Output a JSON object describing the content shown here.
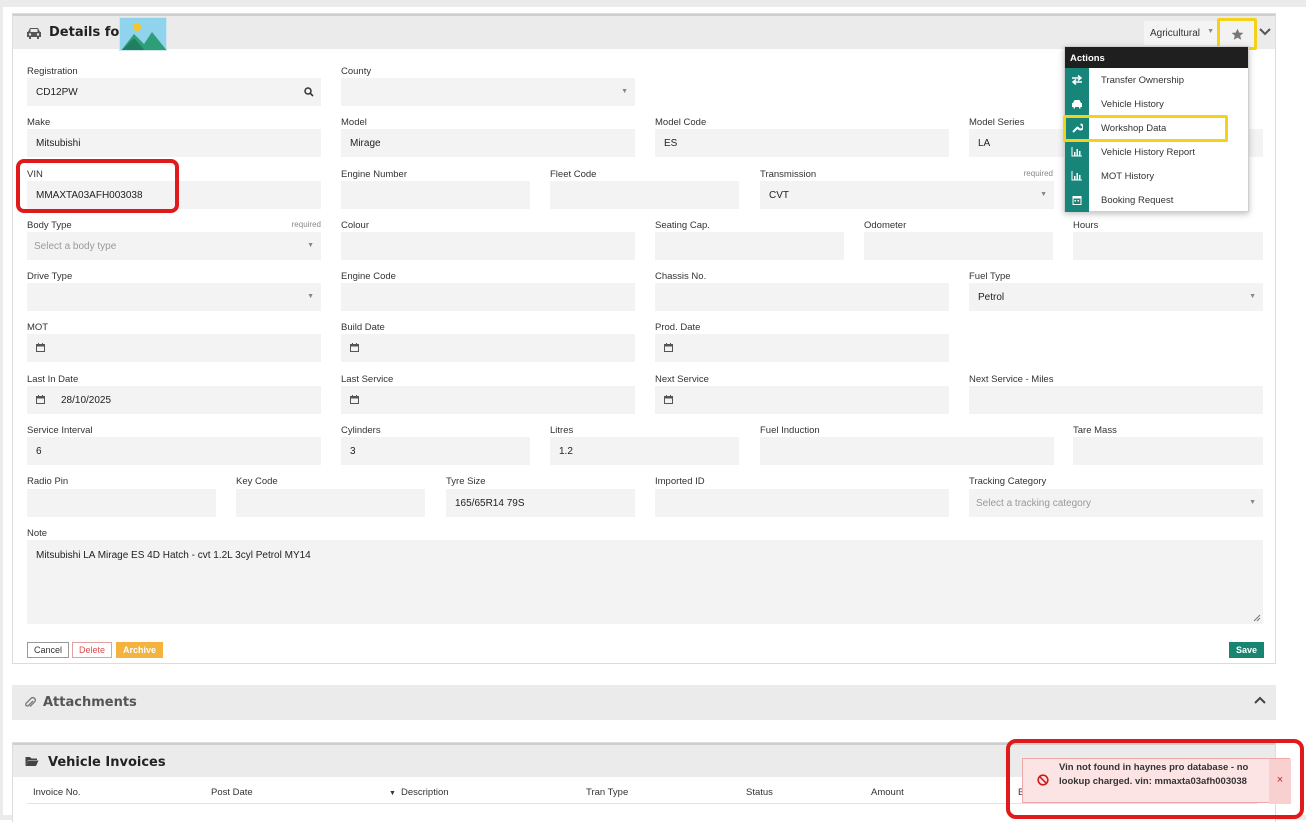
{
  "details": {
    "title": "Details for",
    "vehicle_type": "Agricultural"
  },
  "actions": {
    "heading": "Actions",
    "items": [
      {
        "label": "Transfer Ownership",
        "icon": "transfer-icon"
      },
      {
        "label": "Vehicle History",
        "icon": "car-icon"
      },
      {
        "label": "Workshop Data",
        "icon": "wrench-icon"
      },
      {
        "label": "Vehicle History Report",
        "icon": "bar-chart-icon"
      },
      {
        "label": "MOT History",
        "icon": "bar-chart-icon"
      },
      {
        "label": "Booking Request",
        "icon": "calendar-icon"
      }
    ]
  },
  "form": {
    "registration": {
      "label": "Registration",
      "value": "CD12PW"
    },
    "county": {
      "label": "County",
      "value": ""
    },
    "make": {
      "label": "Make",
      "value": "Mitsubishi"
    },
    "model": {
      "label": "Model",
      "value": "Mirage"
    },
    "model_code": {
      "label": "Model Code",
      "value": "ES"
    },
    "model_series": {
      "label": "Model Series",
      "value": "LA"
    },
    "vin": {
      "label": "VIN",
      "value": "MMAXTA03AFH003038"
    },
    "engine_number": {
      "label": "Engine Number",
      "value": ""
    },
    "fleet_code": {
      "label": "Fleet Code",
      "value": ""
    },
    "transmission": {
      "label": "Transmission",
      "required": "required",
      "value": "CVT"
    },
    "body_type": {
      "label": "Body Type",
      "required": "required",
      "placeholder": "Select a body type"
    },
    "colour": {
      "label": "Colour",
      "value": ""
    },
    "seating_cap": {
      "label": "Seating Cap.",
      "value": ""
    },
    "odometer": {
      "label": "Odometer",
      "value": ""
    },
    "hours": {
      "label": "Hours",
      "value": ""
    },
    "drive_type": {
      "label": "Drive Type",
      "value": ""
    },
    "engine_code": {
      "label": "Engine Code",
      "value": ""
    },
    "chassis_no": {
      "label": "Chassis No.",
      "value": ""
    },
    "fuel_type": {
      "label": "Fuel Type",
      "value": "Petrol"
    },
    "mot": {
      "label": "MOT",
      "value": ""
    },
    "build_date": {
      "label": "Build Date",
      "value": ""
    },
    "prod_date": {
      "label": "Prod. Date",
      "value": ""
    },
    "last_in_date": {
      "label": "Last In Date",
      "value": "28/10/2025"
    },
    "last_service": {
      "label": "Last Service",
      "value": ""
    },
    "next_service": {
      "label": "Next Service",
      "value": ""
    },
    "next_service_miles": {
      "label": "Next Service - Miles",
      "value": ""
    },
    "service_interval": {
      "label": "Service Interval",
      "value": "6"
    },
    "cylinders": {
      "label": "Cylinders",
      "value": "3"
    },
    "litres": {
      "label": "Litres",
      "value": "1.2"
    },
    "fuel_induction": {
      "label": "Fuel Induction",
      "value": ""
    },
    "tare_mass": {
      "label": "Tare Mass",
      "value": ""
    },
    "radio_pin": {
      "label": "Radio Pin",
      "value": ""
    },
    "key_code": {
      "label": "Key Code",
      "value": ""
    },
    "tyre_size": {
      "label": "Tyre Size",
      "value": "165/65R14 79S"
    },
    "imported_id": {
      "label": "Imported ID",
      "value": ""
    },
    "tracking_category": {
      "label": "Tracking Category",
      "placeholder": "Select a tracking category"
    },
    "note": {
      "label": "Note",
      "value": "Mitsubishi LA Mirage ES 4D Hatch - cvt 1.2L 3cyl Petrol MY14"
    }
  },
  "buttons": {
    "cancel": "Cancel",
    "delete": "Delete",
    "archive": "Archive",
    "save": "Save"
  },
  "attachments": {
    "title": "Attachments"
  },
  "invoices": {
    "title": "Vehicle Invoices",
    "columns": [
      "Invoice No.",
      "Post Date",
      "Description",
      "Tran Type",
      "Status",
      "Amount",
      "B"
    ]
  },
  "toast": {
    "message": "Vin not found in haynes pro database - no lookup charged. vin: mmaxta03afh003038",
    "close": "×"
  },
  "colors": {
    "accent": "#17857a",
    "highlight_yellow": "#f4d21a",
    "highlight_red": "#e01a1a",
    "archive": "#f3b33d"
  }
}
